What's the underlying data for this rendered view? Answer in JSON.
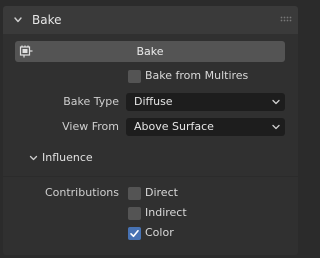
{
  "panel": {
    "title": "Bake",
    "bake_button_label": "Bake",
    "bake_from_multires_label": "Bake from Multires",
    "bake_from_multires_checked": false,
    "bake_type": {
      "label": "Bake Type",
      "value": "Diffuse"
    },
    "view_from": {
      "label": "View From",
      "value": "Above Surface"
    }
  },
  "influence": {
    "title": "Influence",
    "contributions_label": "Contributions",
    "direct": {
      "label": "Direct",
      "checked": false
    },
    "indirect": {
      "label": "Indirect",
      "checked": false
    },
    "color": {
      "label": "Color",
      "checked": true
    }
  },
  "icons": {
    "panel_chevron": "chevron-down-icon",
    "drag_grip": "grip-dots-icon",
    "bake_icon": "render-bake-icon",
    "dropdown_arrow": "chevron-down-icon",
    "checkmark": "checkmark-icon"
  },
  "colors": {
    "background": "#2b2b2b",
    "panel_header": "#3a3a3a",
    "panel_body": "#303030",
    "button": "#545454",
    "dropdown": "#1d1d1d",
    "checkbox_checked": "#4772b3"
  }
}
